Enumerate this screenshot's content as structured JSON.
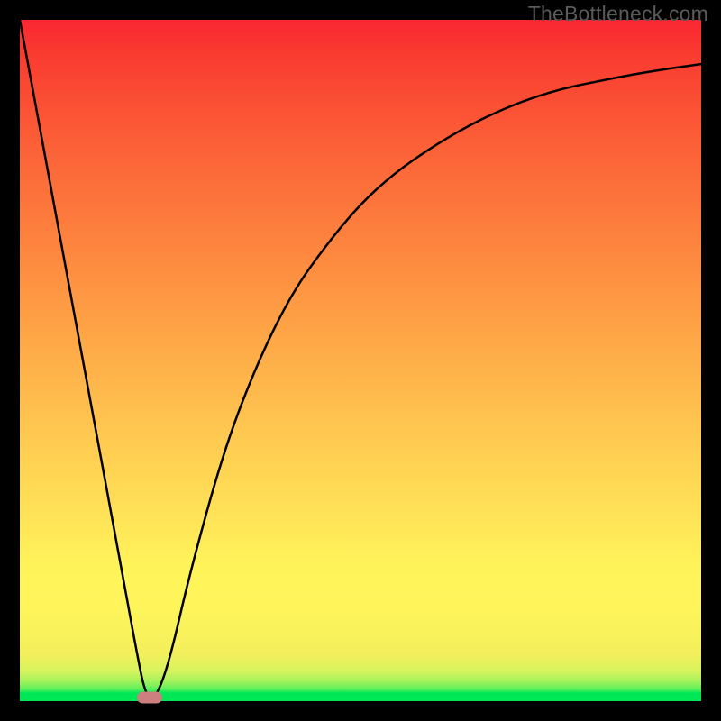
{
  "attribution": "TheBottleneck.com",
  "colors": {
    "background": "#000000",
    "curve": "#000000",
    "marker": "#cd7f7f",
    "gradient_top": "#fa2632",
    "gradient_bottom": "#00e756"
  },
  "chart_data": {
    "type": "line",
    "title": "",
    "xlabel": "",
    "ylabel": "",
    "xlim": [
      0,
      100
    ],
    "ylim": [
      0,
      100
    ],
    "grid": false,
    "legend": false,
    "series": [
      {
        "name": "bottleneck-curve",
        "x": [
          0,
          5,
          10,
          15,
          17,
          18.5,
          20,
          22,
          25,
          30,
          35,
          40,
          45,
          50,
          55,
          60,
          65,
          70,
          75,
          80,
          85,
          90,
          95,
          100
        ],
        "y": [
          100,
          73,
          46,
          19,
          8,
          0.5,
          0.5,
          6,
          19,
          37,
          50,
          60,
          67,
          73,
          77.5,
          81,
          84,
          86.5,
          88.5,
          90,
          91,
          92,
          92.8,
          93.5
        ]
      }
    ],
    "marker": {
      "x": 19,
      "y": 0.5
    },
    "annotations": []
  }
}
